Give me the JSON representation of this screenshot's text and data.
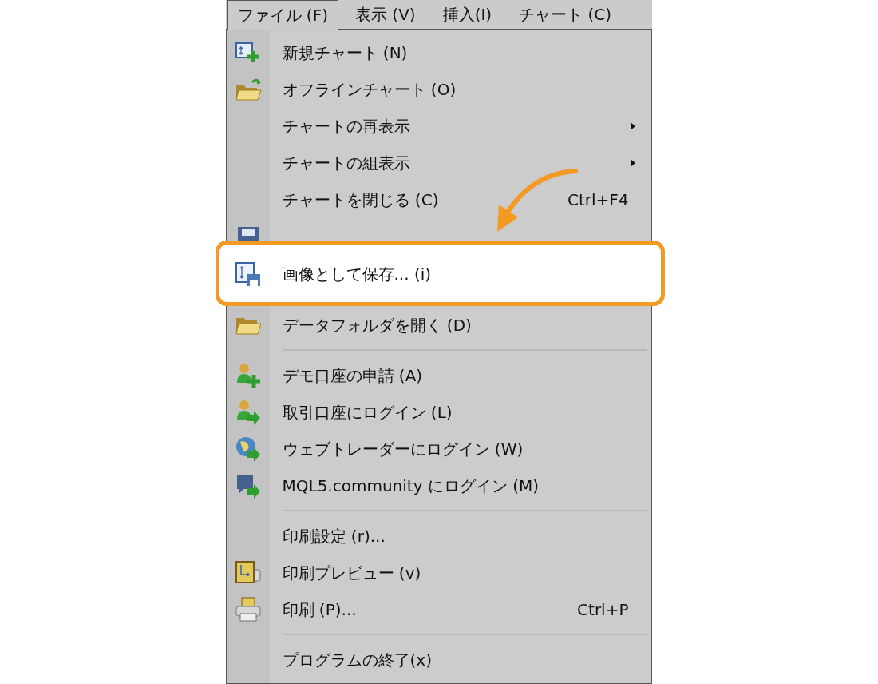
{
  "menu_bar": [
    {
      "label": "ファイル (F)",
      "selected": true
    },
    {
      "label": "表示 (V)",
      "selected": false
    },
    {
      "label": "挿入(I)",
      "selected": false
    },
    {
      "label": "チャート (C)",
      "selected": false
    }
  ],
  "menu": {
    "items": [
      {
        "kind": "item",
        "label": "新規チャート (N)",
        "highlighted": false
      },
      {
        "kind": "item",
        "label": "オフラインチャート (O)",
        "highlighted": false
      },
      {
        "kind": "submenu",
        "label": "チャートの再表示",
        "highlighted": false
      },
      {
        "kind": "submenu",
        "label": "チャートの組表示",
        "highlighted": false
      },
      {
        "kind": "item",
        "label": "チャートを閉じる (C)",
        "shortcut": "Ctrl+F4",
        "highlighted": false
      },
      {
        "kind": "item",
        "highlighted": false
      },
      {
        "kind": "item",
        "label": "画像として保存... (i)",
        "highlighted": true
      },
      {
        "kind": "item",
        "label": "データフォルダを開く (D)",
        "highlighted": false
      },
      {
        "kind": "separator"
      },
      {
        "kind": "item",
        "label": "デモ口座の申請 (A)",
        "highlighted": false
      },
      {
        "kind": "item",
        "label": "取引口座にログイン (L)",
        "highlighted": false
      },
      {
        "kind": "item",
        "label": "ウェブトレーダーにログイン (W)",
        "highlighted": false
      },
      {
        "kind": "item",
        "label": "MQL5.community にログイン (M)",
        "highlighted": false
      },
      {
        "kind": "separator"
      },
      {
        "kind": "item",
        "label": "印刷設定 (r)...",
        "highlighted": false
      },
      {
        "kind": "item",
        "label": "印刷プレビュー (v)",
        "highlighted": false
      },
      {
        "kind": "item",
        "label": "印刷 (P)...",
        "shortcut": "Ctrl+P",
        "highlighted": false
      },
      {
        "kind": "separator"
      },
      {
        "kind": "item",
        "label": "プログラムの終了(x)",
        "highlighted": false
      }
    ]
  }
}
